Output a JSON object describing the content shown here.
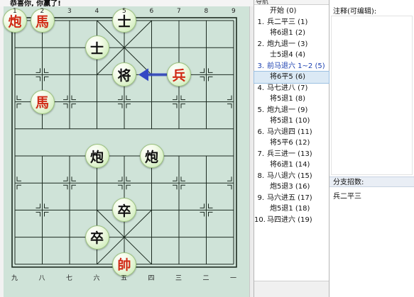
{
  "status": {
    "message": "恭喜你, 你赢了!"
  },
  "board": {
    "top_files": [
      "1",
      "2",
      "3",
      "4",
      "5",
      "6",
      "7",
      "8",
      "9"
    ],
    "bottom_files": [
      "九",
      "八",
      "七",
      "六",
      "五",
      "四",
      "三",
      "二",
      "一"
    ],
    "colors": {
      "board_bg": "#cfe3d8",
      "line": "#1c2a20",
      "red_piece_text": "#d02a15",
      "black_piece_text": "#111111",
      "arrow": "#3347c4"
    },
    "last_move_arrow": {
      "from": "兵",
      "to": "将"
    },
    "pieces": [
      {
        "label": "炮",
        "side": "red",
        "file": 1,
        "rank": 1
      },
      {
        "label": "馬",
        "side": "red",
        "file": 2,
        "rank": 1
      },
      {
        "label": "士",
        "side": "black",
        "file": 5,
        "rank": 1
      },
      {
        "label": "士",
        "side": "black",
        "file": 4,
        "rank": 2
      },
      {
        "label": "将",
        "side": "black",
        "file": 5,
        "rank": 3
      },
      {
        "label": "兵",
        "side": "red",
        "file": 7,
        "rank": 3
      },
      {
        "label": "馬",
        "side": "red",
        "file": 2,
        "rank": 4
      },
      {
        "label": "炮",
        "side": "black",
        "file": 4,
        "rank": 6
      },
      {
        "label": "炮",
        "side": "black",
        "file": 6,
        "rank": 6
      },
      {
        "label": "卒",
        "side": "black",
        "file": 5,
        "rank": 8
      },
      {
        "label": "卒",
        "side": "black",
        "file": 4,
        "rank": 9
      },
      {
        "label": "帥",
        "side": "red",
        "file": 5,
        "rank": 10
      }
    ]
  },
  "navigation": {
    "title": "导航",
    "moves": [
      {
        "num": "",
        "text": "开始 (0)",
        "kind": "start"
      },
      {
        "num": "1.",
        "text": "兵二平三 (1)",
        "kind": "red"
      },
      {
        "num": "",
        "text": "将6退1 (2)",
        "kind": "black"
      },
      {
        "num": "2.",
        "text": "炮九退一 (3)",
        "kind": "red"
      },
      {
        "num": "",
        "text": "士5退4 (4)",
        "kind": "black"
      },
      {
        "num": "3.",
        "text": "前马退六 1~2 (5)",
        "kind": "red",
        "highlight": true
      },
      {
        "num": "",
        "text": "将6平5 (6)",
        "kind": "black",
        "selected": true
      },
      {
        "num": "4.",
        "text": "马七进八 (7)",
        "kind": "red"
      },
      {
        "num": "",
        "text": "将5退1 (8)",
        "kind": "black"
      },
      {
        "num": "5.",
        "text": "炮九退一 (9)",
        "kind": "red"
      },
      {
        "num": "",
        "text": "将5退1 (10)",
        "kind": "black"
      },
      {
        "num": "6.",
        "text": "马六退四 (11)",
        "kind": "red"
      },
      {
        "num": "",
        "text": "将5平6 (12)",
        "kind": "black"
      },
      {
        "num": "7.",
        "text": "兵三进一 (13)",
        "kind": "red"
      },
      {
        "num": "",
        "text": "将6进1 (14)",
        "kind": "black"
      },
      {
        "num": "8.",
        "text": "马八退六 (15)",
        "kind": "red"
      },
      {
        "num": "",
        "text": "炮5退3 (16)",
        "kind": "black"
      },
      {
        "num": "9.",
        "text": "马六进五 (17)",
        "kind": "red"
      },
      {
        "num": "",
        "text": "炮5退1 (18)",
        "kind": "black"
      },
      {
        "num": "10.",
        "text": "马四进六 (19)",
        "kind": "red"
      }
    ]
  },
  "comment": {
    "label": "注释(可编辑):",
    "value": ""
  },
  "branch": {
    "label": "分支招数:",
    "items": [
      "兵二平三"
    ]
  }
}
